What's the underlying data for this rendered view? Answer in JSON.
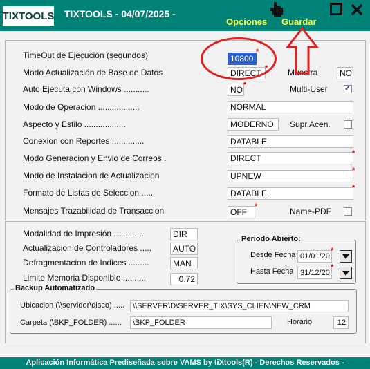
{
  "header": {
    "logo": "TIXTOOLS",
    "title": "TIXTOOLS - 04/07/2025 -",
    "opciones": "Opciones",
    "guardar": "Guardar"
  },
  "config": {
    "timeout_label": "TimeOut de Ejecución (segundos)",
    "timeout_value": "10800",
    "modo_actualizacion_label": "Modo Actualización de Base de Datos",
    "modo_actualizacion_value": "DIRECT",
    "muestra_label": "Muestra",
    "muestra_value": "NO",
    "auto_ejecuta_label": "Auto Ejecuta con Windows ...........",
    "auto_ejecuta_value": "NO",
    "multi_user_label": "Multi-User",
    "modo_operacion_label": "Modo de Operacion ..................",
    "modo_operacion_value": "NORMAL",
    "aspecto_label": "Aspecto y Estilo ..................",
    "aspecto_value": "MODERNO",
    "supr_acen_label": "Supr.Acen.",
    "conexion_label": "Conexion con Reportes ..............",
    "conexion_value": "DATABLE",
    "correos_label": "Modo Generacion y Envio de Correos .",
    "correos_value": "DIRECT",
    "instalacion_label": "Modo de Instalacion de Actualizacion",
    "instalacion_value": "UPNEW",
    "formato_label": "Formato de Listas de Seleccion .....",
    "formato_value": "DATABLE",
    "mensajes_label": "Mensajes Trazabilidad de Transaccion",
    "mensajes_value": "OFF",
    "name_pdf_label": "Name-PDF"
  },
  "extra": {
    "impresion_label": "Modalidad de Impresión .............",
    "impresion_value": "DIR",
    "controladores_label": "Actualizacion de Controladores .....",
    "controladores_value": "AUTO",
    "defrag_label": "Defragmentacion de Indices .........",
    "defrag_value": "MAN",
    "memoria_label": "Limite Memoria Disponible ..........",
    "memoria_value": "0.72"
  },
  "periodo": {
    "title": "Periodo Abierto:",
    "desde_label": "Desde Fecha",
    "desde_value": "01/01/20",
    "hasta_label": "Hasta Fecha",
    "hasta_value": "31/12/20"
  },
  "backup": {
    "title": "Backup Automatizado",
    "ubicacion_label": "Ubicacion (\\\\servidor\\disco) .....",
    "ubicacion_value": "\\\\SERVER\\D\\SERVER_TIX\\SYS_CLIEN\\NEW_CRM",
    "carpeta_label": "Carpeta (\\BKP_FOLDER) ......",
    "carpeta_value": "\\BKP_FOLDER",
    "horario_label": "Horario",
    "horario_value": "12"
  },
  "footer": "Aplicación Informática Prediseñada sobre VAMS by tiXtools(R) - Derechos Reservados -",
  "colors": {
    "header_bg": "#018276",
    "link": "#ffff40",
    "required": "#e00000",
    "annotation": "#e02020"
  }
}
